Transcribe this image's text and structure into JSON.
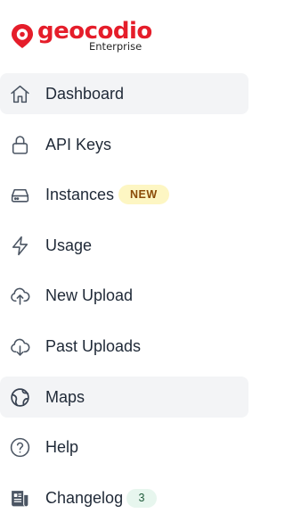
{
  "brand": {
    "name": "geocodio",
    "edition": "Enterprise",
    "color": "#e51d2a"
  },
  "nav": {
    "items": [
      {
        "label": "Dashboard",
        "icon": "home-icon",
        "highlighted": true
      },
      {
        "label": "API Keys",
        "icon": "lock-icon",
        "highlighted": false
      },
      {
        "label": "Instances",
        "icon": "server-icon",
        "highlighted": false,
        "badge": "NEW"
      },
      {
        "label": "Usage",
        "icon": "lightning-icon",
        "highlighted": false
      },
      {
        "label": "New Upload",
        "icon": "cloud-upload-icon",
        "highlighted": false
      },
      {
        "label": "Past Uploads",
        "icon": "cloud-download-icon",
        "highlighted": false
      },
      {
        "label": "Maps",
        "icon": "globe-icon",
        "highlighted": true
      },
      {
        "label": "Help",
        "icon": "question-circle-icon",
        "highlighted": false
      },
      {
        "label": "Changelog",
        "icon": "newspaper-icon",
        "highlighted": false,
        "badge": "3"
      }
    ]
  }
}
